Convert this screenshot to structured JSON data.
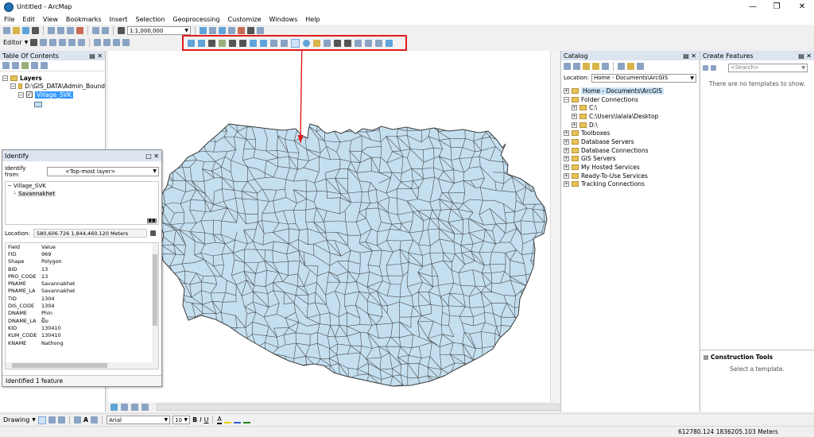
{
  "window": {
    "title": "Untitled - ArcMap"
  },
  "menu": [
    "File",
    "Edit",
    "View",
    "Bookmarks",
    "Insert",
    "Selection",
    "Geoprocessing",
    "Customize",
    "Windows",
    "Help"
  ],
  "toolbar": {
    "scale": "1:1,000,000",
    "editor_label": "Editor"
  },
  "toc": {
    "title": "Table Of Contents",
    "layers_label": "Layers",
    "folder": "D:\\GIS_DATA\\Admin_Bound",
    "layer": "Village_SVK"
  },
  "identify": {
    "title": "Identify",
    "from_label": "Identify from:",
    "from_value": "<Top-most layer>",
    "tree_layer": "Village_SVK",
    "tree_feature": "Savannakhet",
    "location_label": "Location:",
    "location_value": "580,606.726  1,844,460.120 Meters",
    "col_field": "Field",
    "col_value": "Value",
    "rows": [
      [
        "FID",
        "969"
      ],
      [
        "Shape",
        "Polygon"
      ],
      [
        "BID",
        "13"
      ],
      [
        "PRO_CODE",
        "13"
      ],
      [
        "PNAME",
        "Savannakhet"
      ],
      [
        "PNAME_LA",
        "Savannakhet"
      ],
      [
        "TID",
        "1304"
      ],
      [
        "DIS_CODE",
        "1304"
      ],
      [
        "DNAME",
        "Phin"
      ],
      [
        "DNAME_LA",
        "ພິນ"
      ],
      [
        "KID",
        "130410"
      ],
      [
        "KUM_CODE",
        "130410"
      ],
      [
        "KNAME",
        "Nathong"
      ]
    ],
    "status": "Identified 1 feature"
  },
  "catalog": {
    "title": "Catalog",
    "location_label": "Location:",
    "location_value": "Home - Documents\\ArcGIS",
    "items": [
      {
        "label": "Home - Documents\\ArcGIS",
        "level": 0,
        "selected": true
      },
      {
        "label": "Folder Connections",
        "level": 0
      },
      {
        "label": "C:\\",
        "level": 1
      },
      {
        "label": "C:\\Users\\lalala\\Desktop",
        "level": 1
      },
      {
        "label": "D:\\",
        "level": 1
      },
      {
        "label": "Toolboxes",
        "level": 0
      },
      {
        "label": "Database Servers",
        "level": 0
      },
      {
        "label": "Database Connections",
        "level": 0
      },
      {
        "label": "GIS Servers",
        "level": 0
      },
      {
        "label": "My Hosted Services",
        "level": 0
      },
      {
        "label": "Ready-To-Use Services",
        "level": 0
      },
      {
        "label": "Tracking Connections",
        "level": 0
      }
    ]
  },
  "create_features": {
    "title": "Create Features",
    "search_placeholder": "<Search>",
    "empty_text": "There are no templates to show.",
    "construction_title": "Construction Tools",
    "construction_empty": "Select a template."
  },
  "drawing": {
    "label": "Drawing",
    "font": "Arial",
    "size": "10"
  },
  "status": {
    "coords": "612780.124  1836205.103 Meters"
  },
  "colors": {
    "polygon_fill": "#c4dff0",
    "polygon_stroke": "#4a4a4a",
    "highlight": "#e21b1b",
    "selection": "#3399ff"
  }
}
